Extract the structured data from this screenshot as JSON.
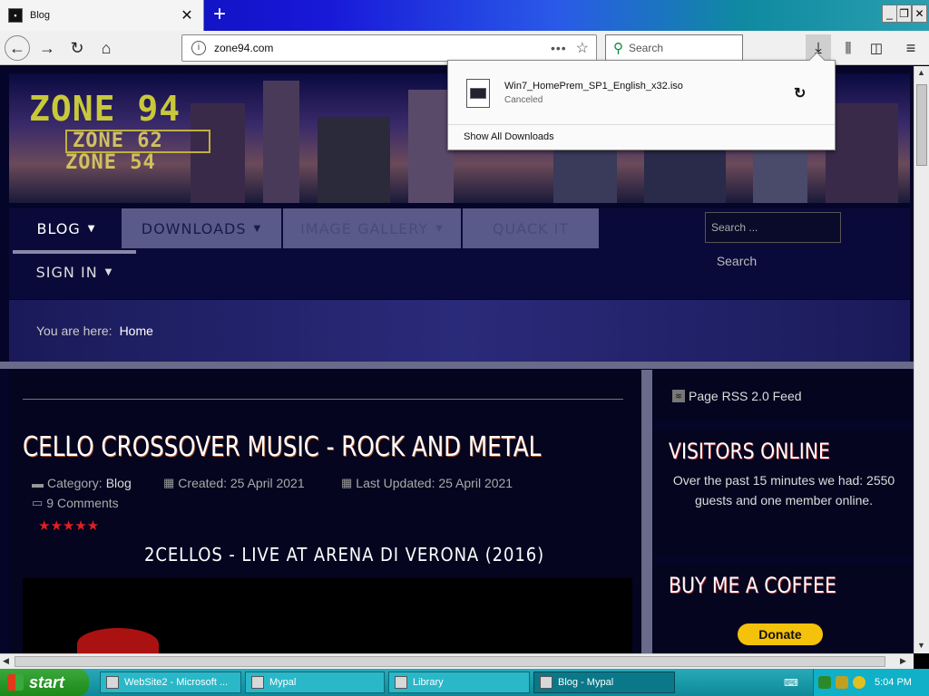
{
  "browser": {
    "tab_title": "Blog",
    "tab_close": "✕",
    "new_tab": "+",
    "url": "zone94.com",
    "url_more": "•••",
    "search_placeholder": "Search",
    "window_controls": {
      "minimize": "_",
      "restore": "❐",
      "close": "✕"
    }
  },
  "downloads_panel": {
    "filename": "Win7_HomePrem_SP1_English_x32.iso",
    "status": "Canceled",
    "show_all": "Show All Downloads"
  },
  "site": {
    "logo_lines": [
      "ZONE 94",
      "ZONE 62",
      "ZONE 54"
    ],
    "nav": [
      {
        "label": "BLOG",
        "caret": "▼"
      },
      {
        "label": "DOWNLOADS",
        "caret": "▼"
      },
      {
        "label": "IMAGE GALLERY",
        "caret": "▼"
      },
      {
        "label": "QUACK IT"
      },
      {
        "label": "SIGN IN",
        "caret": "▼"
      }
    ],
    "search_placeholder": "Search ...",
    "search_button": "Search",
    "breadcrumb": {
      "label": "You are here:",
      "home": "Home"
    }
  },
  "article": {
    "title": "CELLO CROSSOVER MUSIC - ROCK AND METAL",
    "category_label": "Category:",
    "category": "Blog",
    "created": "Created: 25 April 2021",
    "updated": "Last Updated: 25 April 2021",
    "comments": "9 Comments",
    "rating": "★★★★★",
    "video_title": "2CELLOS - LIVE AT ARENA DI VERONA (2016)"
  },
  "sidebar": {
    "rss": "Page RSS 2.0 Feed",
    "visitors_heading": "VISITORS ONLINE",
    "visitors_text": "Over the past 15 minutes we had: 2550 guests and one member online.",
    "coffee_heading": "BUY ME A COFFEE",
    "donate": "Donate"
  },
  "taskbar": {
    "start": "start",
    "tasks": [
      {
        "label": "WebSite2 - Microsoft ..."
      },
      {
        "label": "Mypal"
      },
      {
        "label": "Library"
      },
      {
        "label": "Blog - Mypal"
      }
    ],
    "clock": "5:04 PM"
  },
  "colors": {
    "taskbar": "#1a9aa8",
    "start_button": "#2a9a2a",
    "donate": "#f4c20a",
    "rating": "#e02020"
  }
}
